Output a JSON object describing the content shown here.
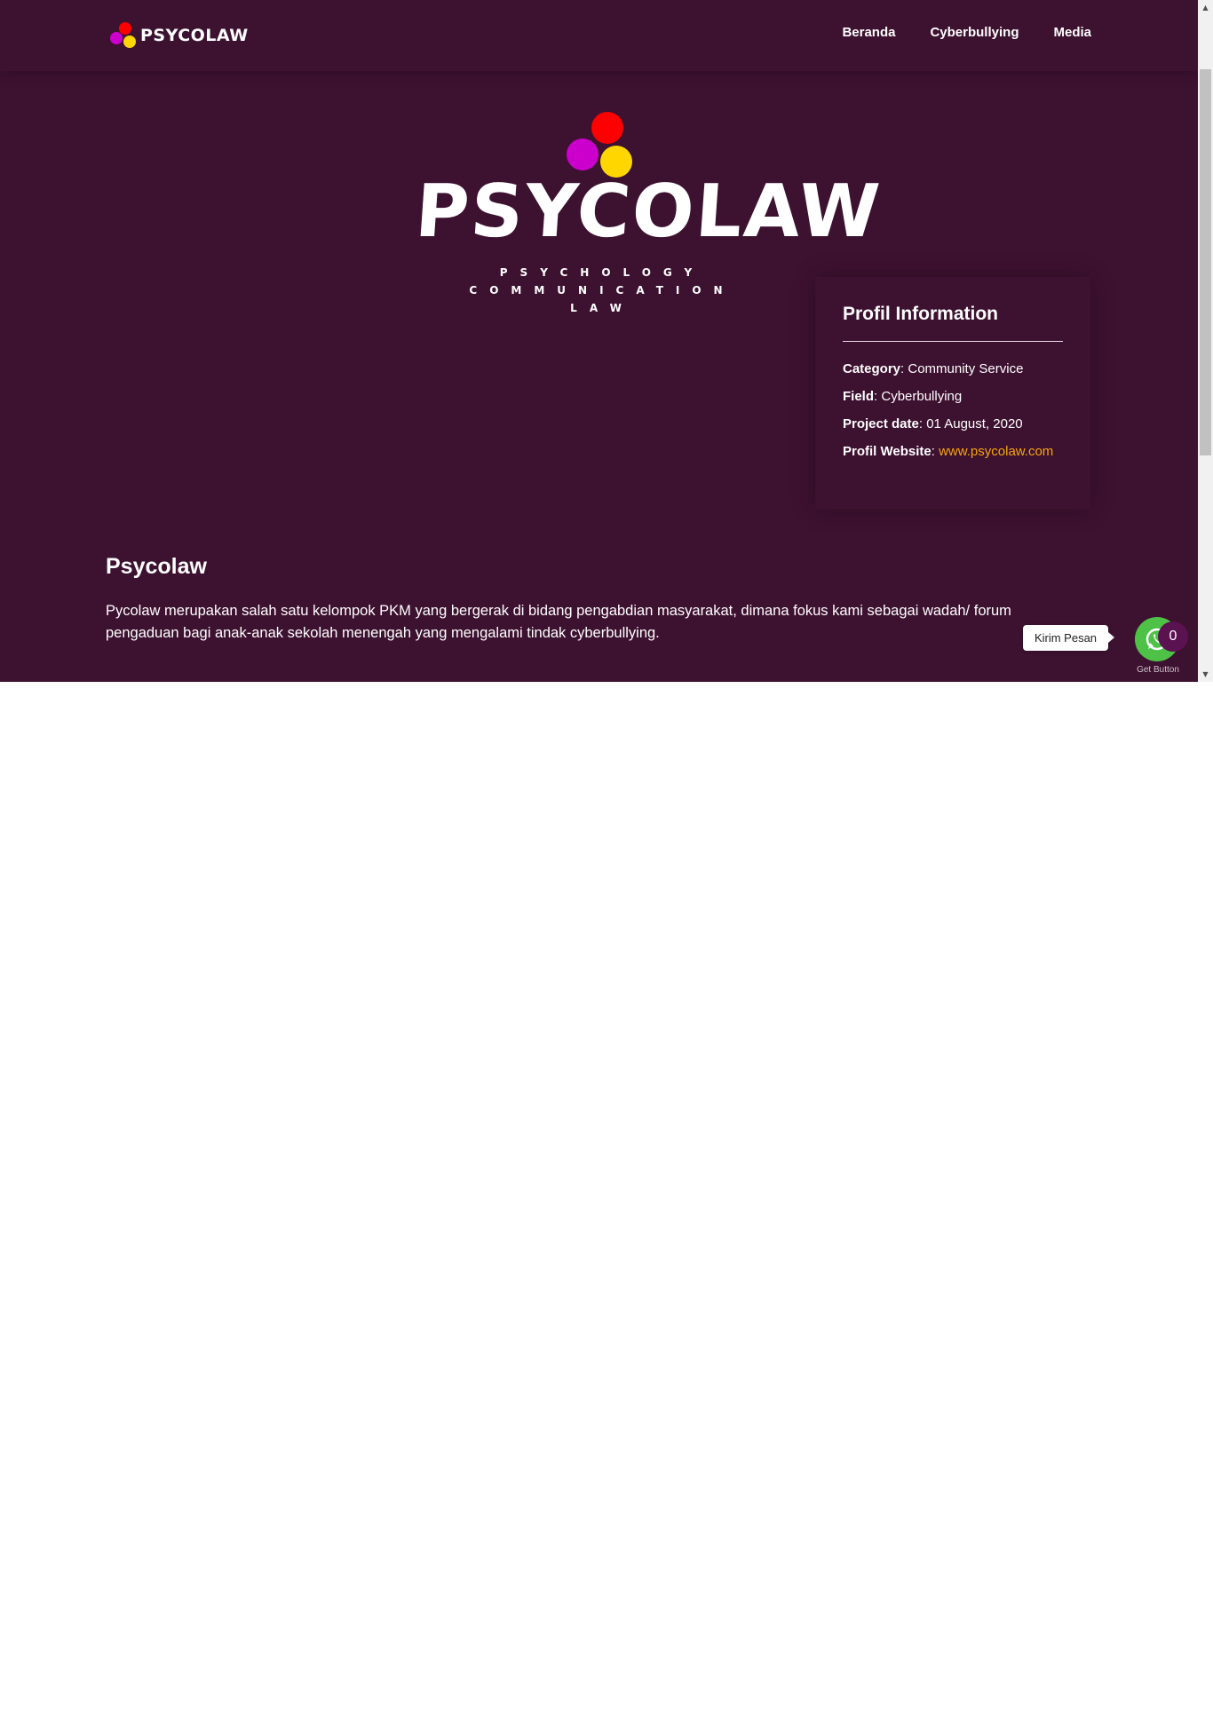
{
  "header": {
    "brand": "PSYCOLAW",
    "nav": [
      "Beranda",
      "Cyberbullying",
      "Media"
    ]
  },
  "hero": {
    "title": "PSYCOLAW",
    "tag_lines": [
      "PSYCHOLOGY",
      "COMMUNICATION",
      "LAW"
    ]
  },
  "info_card": {
    "title": "Profil Information",
    "category_label": "Category",
    "category_value": "Community Service",
    "field_label": "Field",
    "field_value": "Cyberbullying",
    "project_date_label": "Project date",
    "project_date_value": "01 August, 2020",
    "website_label": "Profil Website",
    "website_value": "www.psycolaw.com"
  },
  "description": {
    "title": "Psycolaw",
    "text": "Pycolaw merupakan salah satu kelompok PKM yang bergerak di bidang pengabdian masyarakat, dimana fokus kami sebagai wadah/ forum pengaduan bagi anak-anak sekolah menengah yang mengalami tindak cyberbullying."
  },
  "whatsapp": {
    "bubble_text": "Kirim Pesan",
    "badge_count": "0",
    "getbutton_label": "Get Button",
    "icon": "whatsapp-icon"
  },
  "colors": {
    "background": "#3d1130",
    "accent": "#f6a609",
    "dot_red": "#ff0000",
    "dot_purple": "#cc00cc",
    "dot_yellow": "#ffd600",
    "whatsapp_green": "#4dc247"
  }
}
